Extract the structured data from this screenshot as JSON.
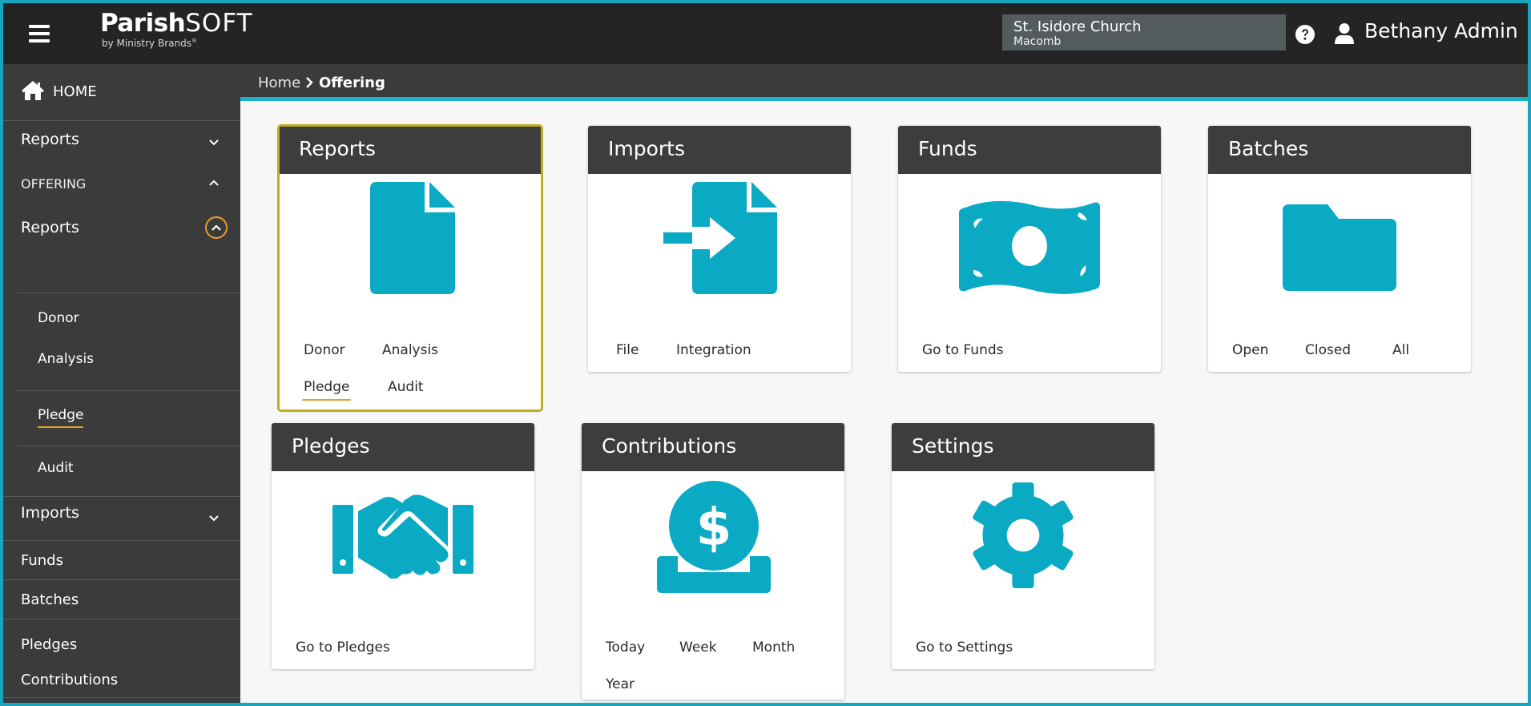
{
  "colors": {
    "accent": "#19b0c9",
    "topbar": "#242424",
    "sidebar": "#3b3b3b",
    "focus_ring": "#e2a12a",
    "selected_outline": "#bfae1e"
  },
  "header": {
    "logo_bold": "Parish",
    "logo_light": "SOFT",
    "logo_sub": "by Ministry Brands",
    "logo_mark": "®",
    "church_name": "St. Isidore Church",
    "church_city": "Macomb",
    "user_name": "Bethany Admin",
    "icons": [
      "menu-icon",
      "help-icon",
      "user-icon"
    ]
  },
  "sidebar": {
    "home": "HOME",
    "reports": "Reports",
    "offering": "OFFERING",
    "offering_reports": "Reports",
    "sub_items": [
      "Donor",
      "Analysis",
      "Pledge",
      "Audit"
    ],
    "imports": "Imports",
    "funds": "Funds",
    "batches": "Batches",
    "pledges": "Pledges",
    "contributions": "Contributions"
  },
  "breadcrumb": {
    "home": "Home",
    "current": "Offering"
  },
  "cards": {
    "reports": {
      "title": "Reports",
      "links": [
        "Donor",
        "Analysis",
        "Pledge",
        "Audit"
      ]
    },
    "imports": {
      "title": "Imports",
      "links": [
        "File",
        "Integration"
      ]
    },
    "funds": {
      "title": "Funds",
      "links": [
        "Go to Funds"
      ]
    },
    "batches": {
      "title": "Batches",
      "links": [
        "Open",
        "Closed",
        "All"
      ]
    },
    "pledges": {
      "title": "Pledges",
      "links": [
        "Go to Pledges"
      ]
    },
    "contributions": {
      "title": "Contributions",
      "links": [
        "Today",
        "Week",
        "Month",
        "Year"
      ]
    },
    "settings": {
      "title": "Settings",
      "links": [
        "Go to Settings"
      ]
    }
  }
}
